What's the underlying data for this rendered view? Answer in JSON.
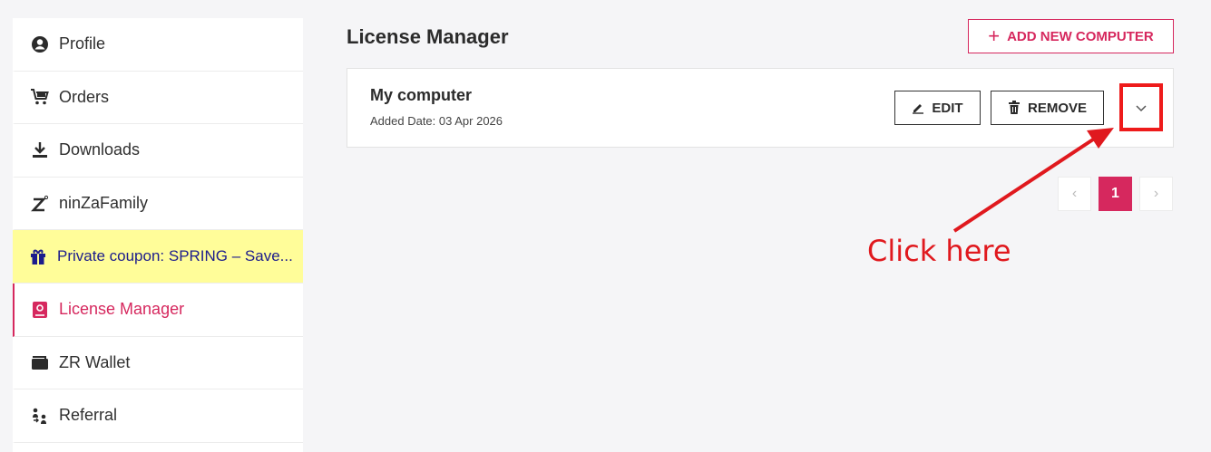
{
  "sidebar": {
    "items": [
      {
        "label": "Profile",
        "icon": "user-circle-icon"
      },
      {
        "label": "Orders",
        "icon": "cart-icon"
      },
      {
        "label": "Downloads",
        "icon": "download-icon"
      },
      {
        "label": "ninZaFamily",
        "icon": "ninza-z-icon"
      },
      {
        "label": "Private coupon: SPRING – Save...",
        "icon": "gift-icon"
      },
      {
        "label": "License Manager",
        "icon": "license-icon"
      },
      {
        "label": "ZR Wallet",
        "icon": "wallet-icon"
      },
      {
        "label": "Referral",
        "icon": "referral-icon"
      }
    ]
  },
  "main": {
    "title": "License Manager",
    "add_button": "ADD NEW COMPUTER",
    "computers": [
      {
        "name": "My computer",
        "date": "Added Date: 03 Apr 2026",
        "edit": "EDIT",
        "remove": "REMOVE"
      }
    ],
    "pagination": {
      "prev": "‹",
      "current": "1",
      "next": "›"
    }
  },
  "annotation": {
    "text": "Click here"
  },
  "colors": {
    "accent": "#d6285e",
    "highlight": "#ee1b1b",
    "coupon_bg": "#fffd99"
  }
}
